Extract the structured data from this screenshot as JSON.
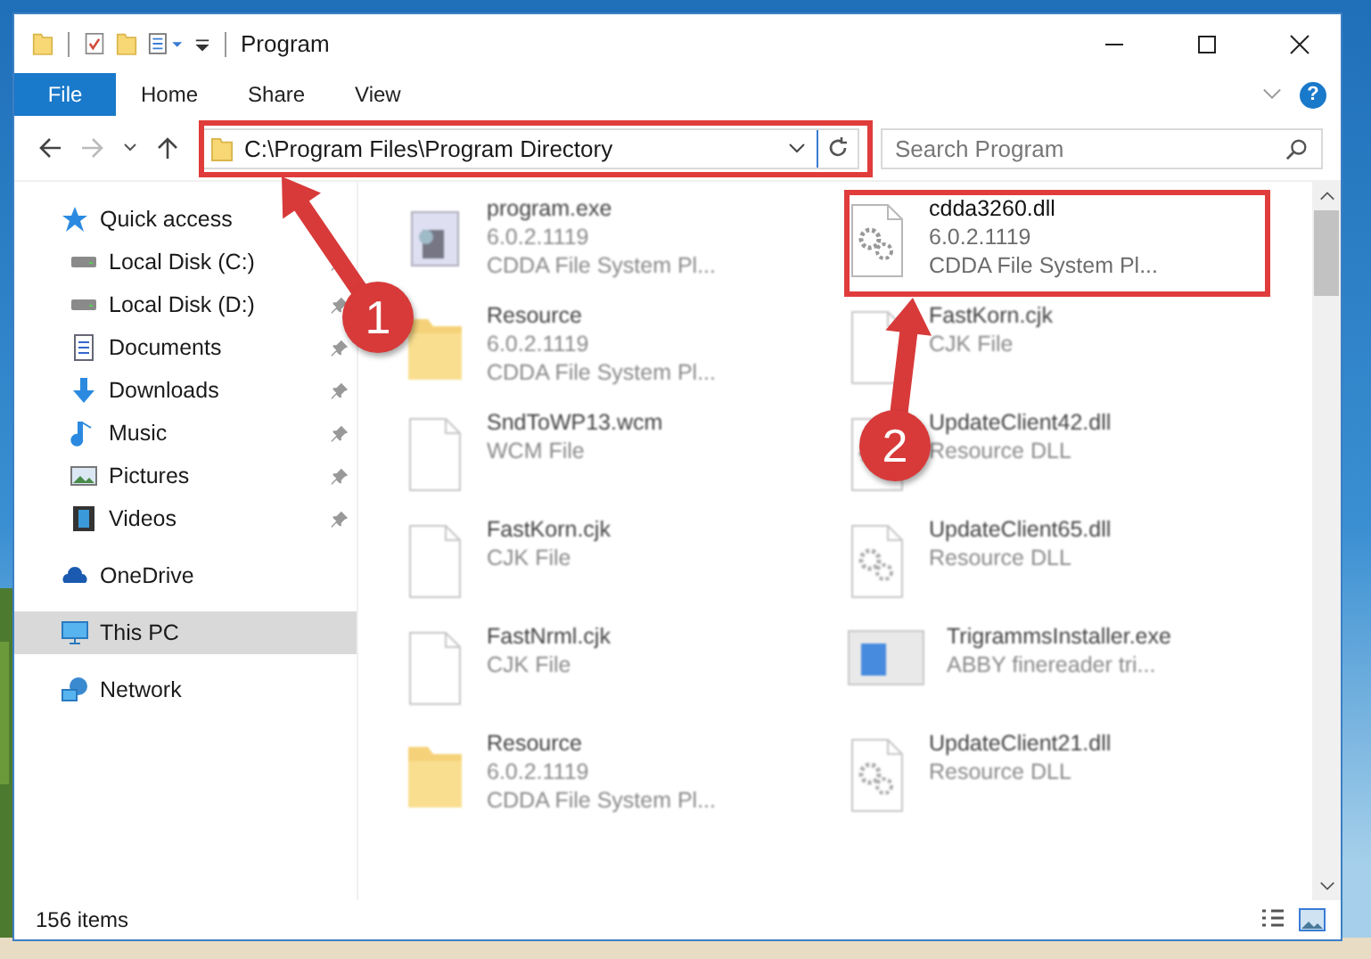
{
  "window": {
    "title": "Program"
  },
  "ribbon": {
    "tabs": [
      {
        "label": "File",
        "selected": true
      },
      {
        "label": "Home",
        "selected": false
      },
      {
        "label": "Share",
        "selected": false
      },
      {
        "label": "View",
        "selected": false
      }
    ],
    "help": "?"
  },
  "address": {
    "path": "C:\\Program Files\\Program Directory"
  },
  "search": {
    "placeholder": "Search Program"
  },
  "navigation": [
    {
      "label": "Quick access",
      "kind": "quick",
      "selected": false,
      "children": [
        {
          "label": "Local Disk (C:)",
          "kind": "disk",
          "selected": false,
          "pinned": true
        },
        {
          "label": "Local Disk (D:)",
          "kind": "disk",
          "selected": false,
          "pinned": true
        },
        {
          "label": "Documents",
          "kind": "documents",
          "selected": false,
          "pinned": true
        },
        {
          "label": "Downloads",
          "kind": "downloads",
          "selected": false,
          "pinned": true
        },
        {
          "label": "Music",
          "kind": "music",
          "selected": false,
          "pinned": true
        },
        {
          "label": "Pictures",
          "kind": "pictures",
          "selected": false,
          "pinned": true
        },
        {
          "label": "Videos",
          "kind": "videos",
          "selected": false,
          "pinned": true
        }
      ]
    },
    {
      "label": "OneDrive",
      "kind": "onedrive",
      "selected": false
    },
    {
      "label": "This PC",
      "kind": "pc",
      "selected": true
    },
    {
      "label": "Network",
      "kind": "network",
      "selected": false
    }
  ],
  "files": [
    {
      "name": "program.exe",
      "kind": "exe",
      "blurred": true,
      "details": [
        "6.0.2.1119",
        "CDDA File System Pl..."
      ]
    },
    {
      "name": "cdda3260.dll",
      "kind": "dll",
      "blurred": false,
      "details": [
        "6.0.2.1119",
        "CDDA File System Pl..."
      ]
    },
    {
      "name": "Resource",
      "kind": "folder",
      "blurred": true,
      "details": [
        "6.0.2.1119",
        "CDDA File System Pl..."
      ]
    },
    {
      "name": "FastKorn.cjk",
      "kind": "file",
      "blurred": true,
      "details": [
        "CJK File"
      ]
    },
    {
      "name": "SndToWP13.wcm",
      "kind": "file",
      "blurred": true,
      "details": [
        "WCM File"
      ]
    },
    {
      "name": "UpdateClient42.dll",
      "kind": "dll",
      "blurred": true,
      "details": [
        "Resource DLL"
      ]
    },
    {
      "name": "FastKorn.cjk",
      "kind": "file",
      "blurred": true,
      "details": [
        "CJK File"
      ]
    },
    {
      "name": "UpdateClient65.dll",
      "kind": "dll",
      "blurred": true,
      "details": [
        "Resource DLL"
      ]
    },
    {
      "name": "FastNrml.cjk",
      "kind": "file",
      "blurred": true,
      "details": [
        "CJK File"
      ]
    },
    {
      "name": "TrigrammsInstaller.exe",
      "kind": "installer",
      "blurred": true,
      "details": [
        "ABBY finereader tri..."
      ]
    },
    {
      "name": "Resource",
      "kind": "folder",
      "blurred": true,
      "details": [
        "6.0.2.1119",
        "CDDA File System Pl..."
      ]
    },
    {
      "name": "UpdateClient21.dll",
      "kind": "dll",
      "blurred": true,
      "details": [
        "Resource DLL"
      ]
    }
  ],
  "status_bar": {
    "count": "156 items"
  },
  "callouts": [
    {
      "number": "1"
    },
    {
      "number": "2"
    }
  ]
}
